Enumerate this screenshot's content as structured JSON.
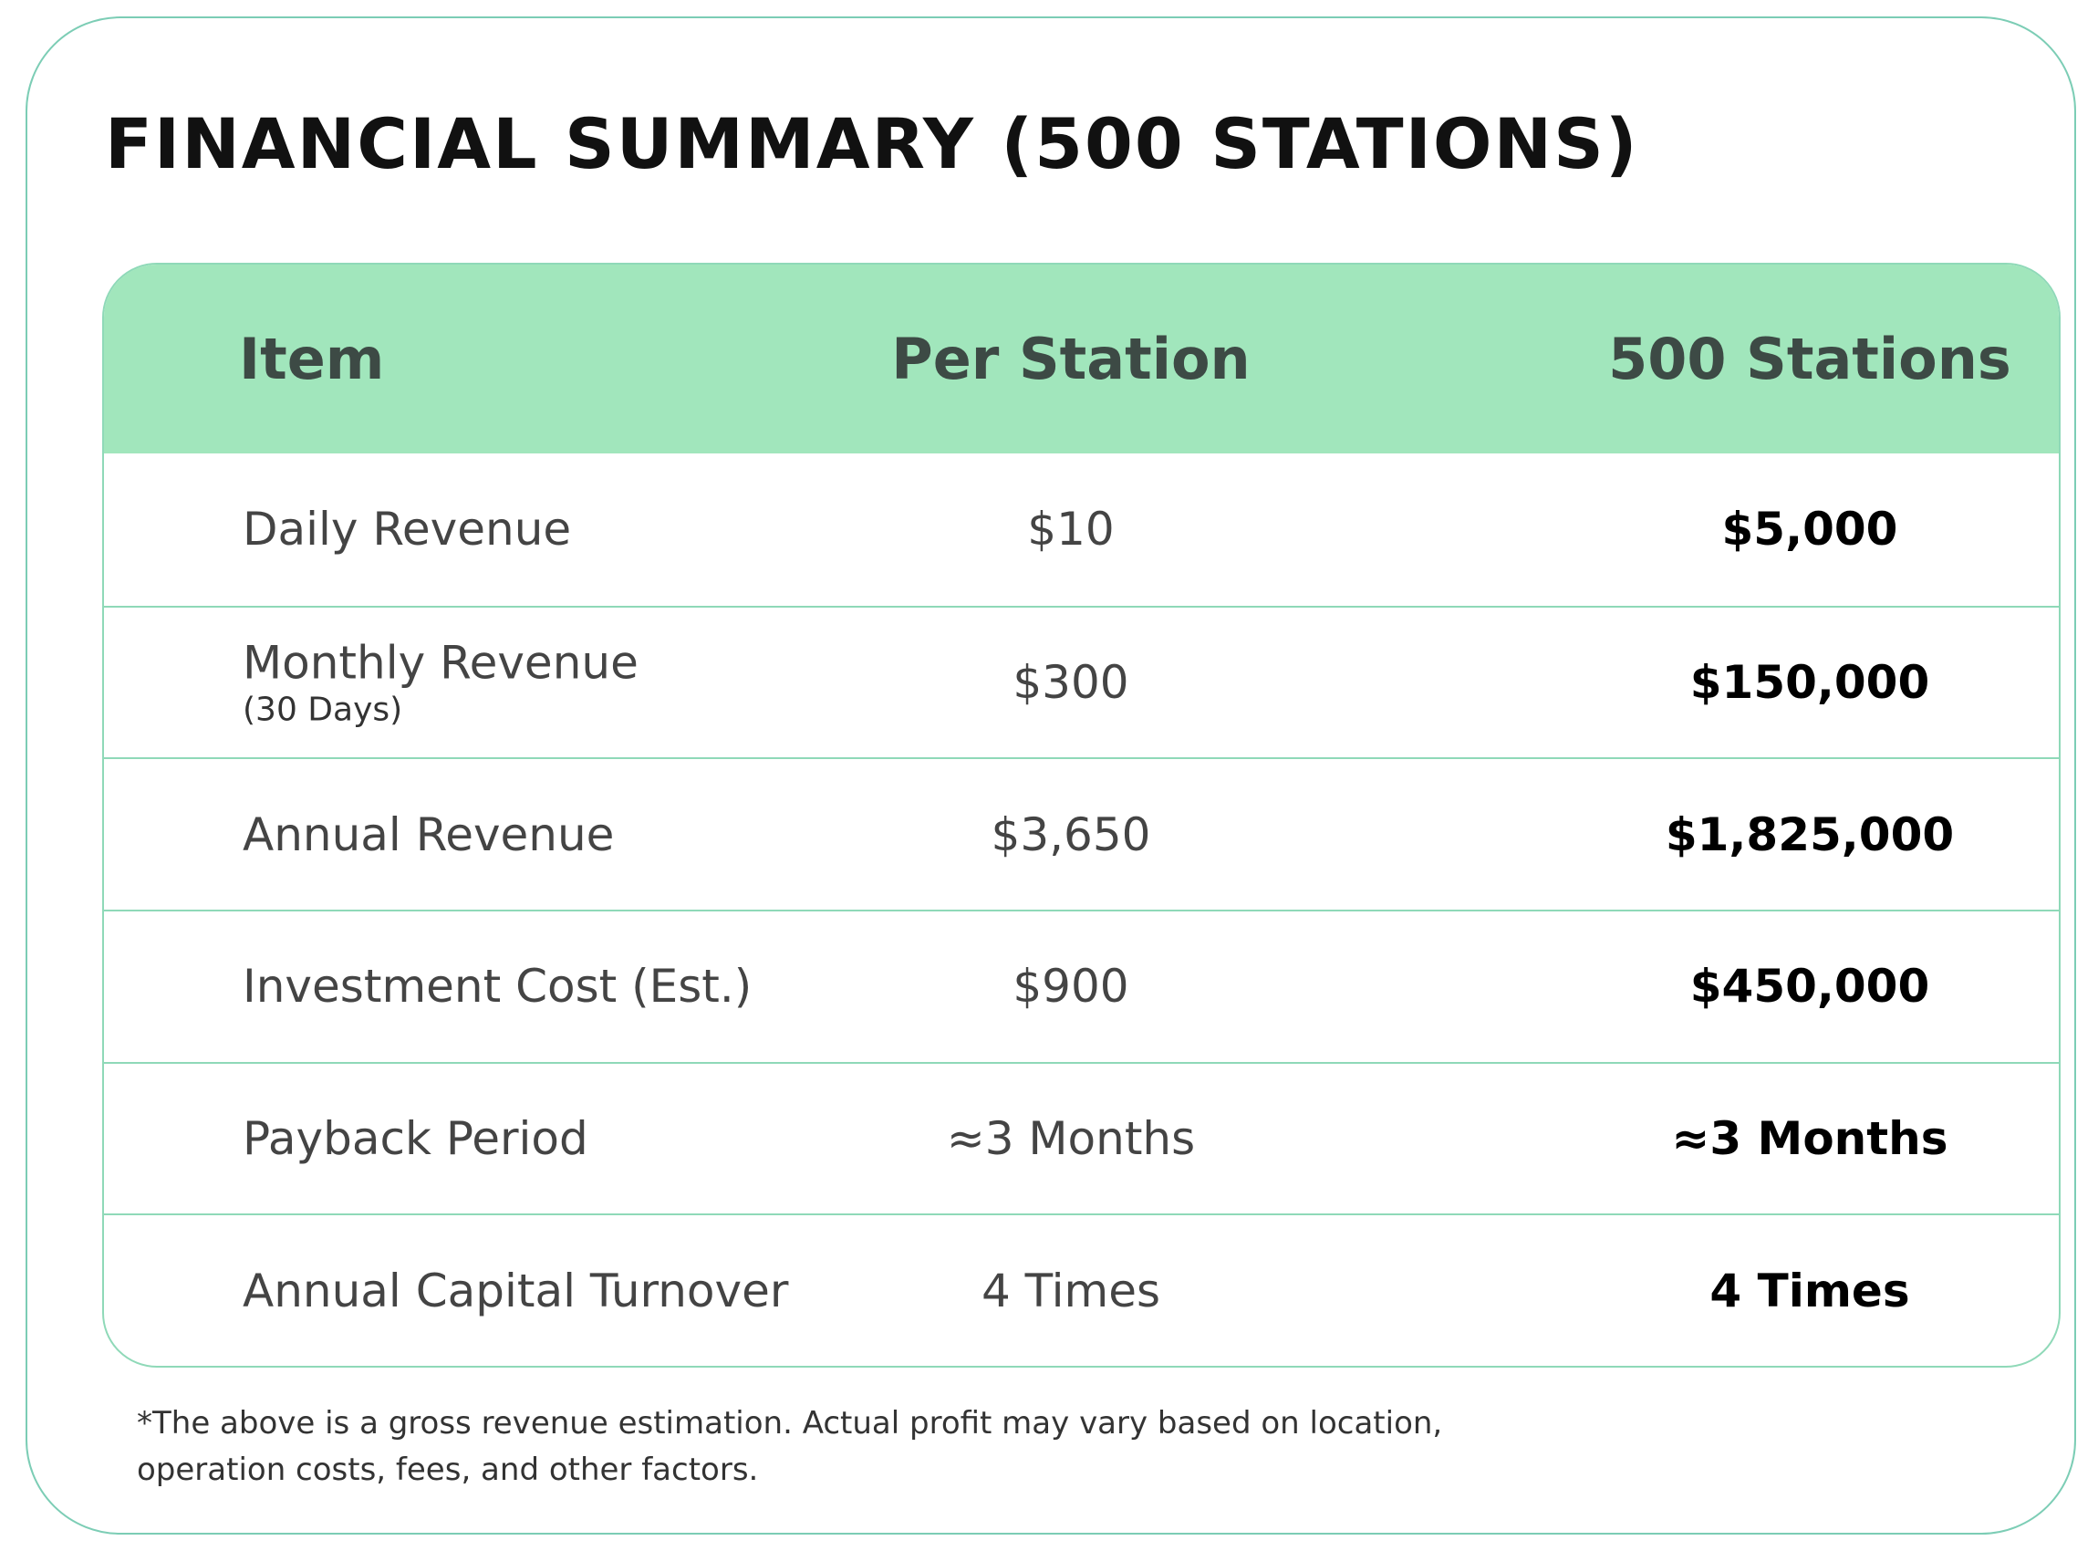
{
  "title": "FINANCIAL SUMMARY (500 STATIONS)",
  "table": {
    "headers": {
      "item": "Item",
      "per_station": "Per Station",
      "total": "500 Stations"
    },
    "rows": [
      {
        "item": "Daily Revenue",
        "sub": "",
        "per_station": "$10",
        "total": "$5,000"
      },
      {
        "item": "Monthly Revenue",
        "sub": "(30 Days)",
        "per_station": "$300",
        "total": "$150,000"
      },
      {
        "item": "Annual Revenue",
        "sub": "",
        "per_station": "$3,650",
        "total": "$1,825,000"
      },
      {
        "item": "Investment Cost (Est.)",
        "sub": "",
        "per_station": "$900",
        "total": "$450,000"
      },
      {
        "item": "Payback Period",
        "sub": "",
        "per_station": "≈3 Months",
        "total": "≈3 Months"
      },
      {
        "item": "Annual Capital Turnover",
        "sub": "",
        "per_station": "4 Times",
        "total": "4 Times"
      }
    ]
  },
  "footnote": {
    "line1": "*The above is a gross revenue estimation. Actual profit may vary based on location,",
    "line2": "operation costs, fees, and other factors."
  },
  "colors": {
    "header_bg": "#a1e6bc",
    "border": "#8fd9b8",
    "card_border": "#7ccdb5"
  }
}
